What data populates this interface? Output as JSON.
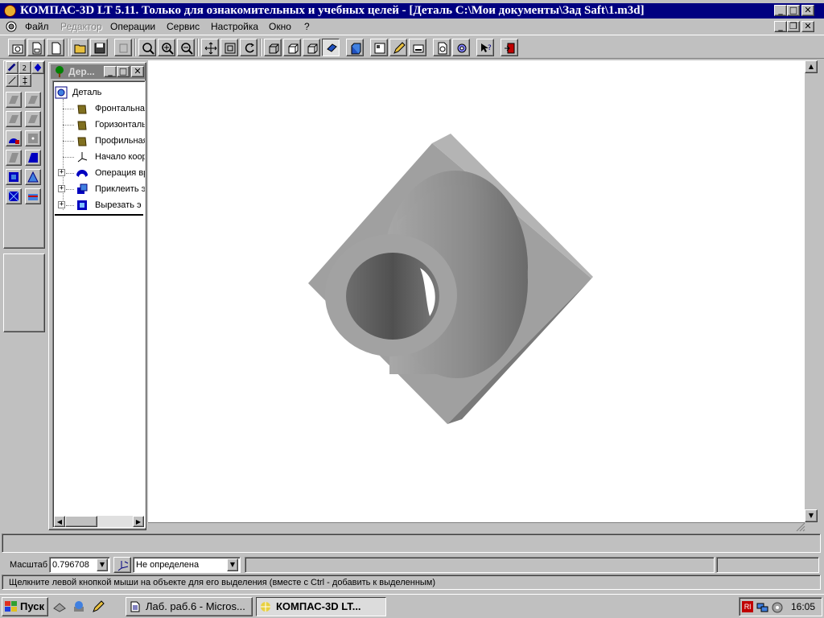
{
  "window": {
    "title": "КОМПАС-3D LT 5.11. Только для ознакомительных и учебных целей - [Деталь С:\\Мои документы\\Зад Saft\\1.m3d]"
  },
  "menu": [
    "Файл",
    "Редактор",
    "Операции",
    "Сервис",
    "Настройка",
    "Окно",
    "?"
  ],
  "tree": {
    "title": "Дер...",
    "root": "Деталь",
    "items": [
      {
        "label": "Фронтальна",
        "icon": "plane-icon"
      },
      {
        "label": "Горизонталь",
        "icon": "plane-icon"
      },
      {
        "label": "Профильная",
        "icon": "plane-icon"
      },
      {
        "label": "Начало коор",
        "icon": "axes-icon"
      },
      {
        "label": "Операция вр",
        "icon": "rotate-op-icon"
      },
      {
        "label": "Приклеить э",
        "icon": "extrude-op-icon"
      },
      {
        "label": "Вырезать э",
        "icon": "cut-op-icon"
      }
    ]
  },
  "props": {
    "scale_label": "Масштаб",
    "scale_value": "0.796708",
    "orient_value": "Не определена"
  },
  "status_message": "Щелкните левой кнопкой мыши на объекте для его выделения (вместе с Ctrl - добавить к выделенным)",
  "taskbar": {
    "start": "Пуск",
    "tasks": [
      "Лаб. раб.6 - Micros...",
      "КОМПАС-3D LT..."
    ],
    "tray_lang": "Rl",
    "clock": "16:05"
  },
  "colors": {
    "titlebar": "#000080",
    "face_dark": "#c0c0c0",
    "viewport": "#ffffff"
  }
}
